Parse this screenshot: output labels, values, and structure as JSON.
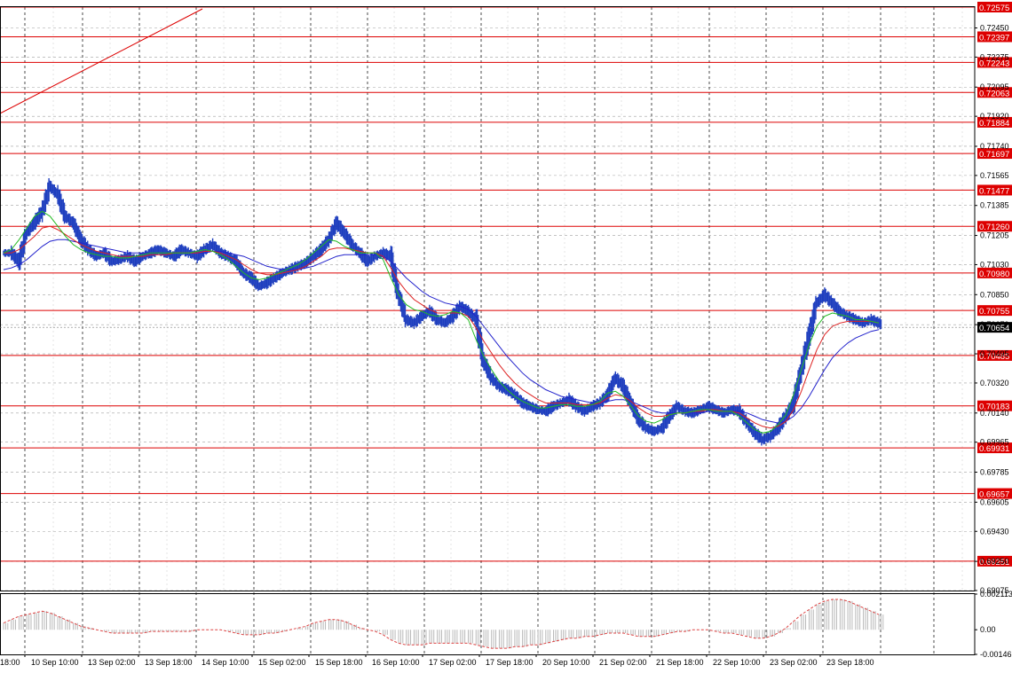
{
  "chart_data": {
    "type": "line",
    "style": "bars",
    "instrument_colors": {
      "price": "#1f3fbf",
      "ma_fast": "#22bb22",
      "ma_mid": "#dd2222",
      "ma_slow": "#2222cc",
      "levels": "#dd0000",
      "current_label_bg": "#000000",
      "grid": "#a0a0a0",
      "oscillator": "#dd4444"
    },
    "ylim": [
      0.69075,
      0.72575
    ],
    "y_ticks": [
      "0.72450",
      "0.72275",
      "0.72095",
      "0.71920",
      "0.71740",
      "0.71565",
      "0.71385",
      "0.71205",
      "0.71030",
      "0.70850",
      "0.70670",
      "0.70495",
      "0.70320",
      "0.70140",
      "0.69965",
      "0.69785",
      "0.69605",
      "0.69430",
      "0.69250",
      "0.69075"
    ],
    "x_labels": [
      "10 Sep 10:00",
      "13 Sep 02:00",
      "13 Sep 18:00",
      "14 Sep 10:00",
      "15 Sep 02:00",
      "15 Sep 18:00",
      "16 Sep 10:00",
      "17 Sep 02:00",
      "17 Sep 18:00",
      "20 Sep 10:00",
      "21 Sep 02:00",
      "21 Sep 18:00",
      "22 Sep 10:00",
      "23 Sep 02:00",
      "23 Sep 18:00"
    ],
    "x_label_left_partial": "18:00",
    "levels": [
      "0.72575",
      "0.72397",
      "0.72243",
      "0.72063",
      "0.71884",
      "0.71697",
      "0.71477",
      "0.71260",
      "0.70980",
      "0.70755",
      "0.70485",
      "0.70183",
      "0.69931",
      "0.69657",
      "0.69251"
    ],
    "current_price": "0.70654",
    "price_series": [
      0.711,
      0.7105,
      0.7122,
      0.7128,
      0.7135,
      0.715,
      0.7145,
      0.7132,
      0.7128,
      0.7118,
      0.7112,
      0.7108,
      0.711,
      0.7105,
      0.7106,
      0.7108,
      0.7105,
      0.7108,
      0.711,
      0.7112,
      0.711,
      0.7108,
      0.7112,
      0.711,
      0.7108,
      0.7112,
      0.7115,
      0.711,
      0.7108,
      0.7105,
      0.7098,
      0.7095,
      0.709,
      0.7092,
      0.7095,
      0.7098,
      0.71,
      0.7102,
      0.7104,
      0.7108,
      0.7112,
      0.7118,
      0.7128,
      0.7122,
      0.7115,
      0.711,
      0.7105,
      0.7108,
      0.711,
      0.7108,
      0.7085,
      0.707,
      0.7068,
      0.7072,
      0.7075,
      0.707,
      0.7068,
      0.7072,
      0.7078,
      0.7075,
      0.707,
      0.7045,
      0.7035,
      0.703,
      0.7028,
      0.7025,
      0.702,
      0.7018,
      0.7016,
      0.7015,
      0.7018,
      0.702,
      0.7022,
      0.7018,
      0.7015,
      0.7018,
      0.702,
      0.7025,
      0.7035,
      0.703,
      0.702,
      0.701,
      0.7005,
      0.7003,
      0.7005,
      0.7012,
      0.7018,
      0.7015,
      0.7014,
      0.7016,
      0.7018,
      0.7016,
      0.7014,
      0.7016,
      0.7015,
      0.7008,
      0.7002,
      0.6998,
      0.7,
      0.7005,
      0.7012,
      0.702,
      0.704,
      0.706,
      0.708,
      0.7085,
      0.708,
      0.7075,
      0.7072,
      0.707,
      0.7068,
      0.707,
      0.7068,
      0.70654
    ],
    "ma_fast_series": [
      0.711,
      0.7112,
      0.7118,
      0.7125,
      0.7132,
      0.7135,
      0.7132,
      0.7126,
      0.712,
      0.7115,
      0.7112,
      0.711,
      0.7109,
      0.7108,
      0.7108,
      0.7107,
      0.7107,
      0.7108,
      0.7109,
      0.711,
      0.711,
      0.711,
      0.711,
      0.711,
      0.711,
      0.7111,
      0.7112,
      0.7111,
      0.7109,
      0.7106,
      0.7102,
      0.7098,
      0.7095,
      0.7094,
      0.7095,
      0.7097,
      0.7099,
      0.7101,
      0.7103,
      0.7106,
      0.711,
      0.7114,
      0.7118,
      0.7117,
      0.7114,
      0.7112,
      0.711,
      0.711,
      0.711,
      0.7106,
      0.7095,
      0.7085,
      0.7079,
      0.7076,
      0.7075,
      0.7073,
      0.7072,
      0.7073,
      0.7075,
      0.7074,
      0.707,
      0.7058,
      0.7048,
      0.704,
      0.7033,
      0.7028,
      0.7024,
      0.7021,
      0.7019,
      0.7017,
      0.7017,
      0.7018,
      0.7019,
      0.7019,
      0.7018,
      0.7018,
      0.7019,
      0.7021,
      0.7026,
      0.7027,
      0.7024,
      0.7018,
      0.7012,
      0.7009,
      0.7008,
      0.701,
      0.7013,
      0.7014,
      0.7014,
      0.7015,
      0.7016,
      0.7016,
      0.7015,
      0.7015,
      0.7015,
      0.7012,
      0.7008,
      0.7004,
      0.7002,
      0.7003,
      0.7007,
      0.7013,
      0.7025,
      0.704,
      0.7055,
      0.7066,
      0.7072,
      0.7074,
      0.7073,
      0.7072,
      0.707,
      0.707,
      0.7069,
      0.7068
    ],
    "ma_mid_series": [
      0.711,
      0.711,
      0.7112,
      0.7116,
      0.712,
      0.7125,
      0.7126,
      0.7124,
      0.7121,
      0.7118,
      0.7115,
      0.7113,
      0.7111,
      0.711,
      0.7109,
      0.7108,
      0.7108,
      0.7108,
      0.7108,
      0.7109,
      0.7109,
      0.7109,
      0.711,
      0.711,
      0.711,
      0.711,
      0.7111,
      0.7111,
      0.711,
      0.7108,
      0.7106,
      0.7103,
      0.71,
      0.7098,
      0.7097,
      0.7097,
      0.7098,
      0.7099,
      0.71,
      0.7102,
      0.7105,
      0.7108,
      0.7112,
      0.7113,
      0.7113,
      0.7112,
      0.7111,
      0.711,
      0.711,
      0.7108,
      0.7101,
      0.7093,
      0.7087,
      0.7082,
      0.7079,
      0.7076,
      0.7074,
      0.7074,
      0.7074,
      0.7074,
      0.7072,
      0.7065,
      0.7057,
      0.705,
      0.7043,
      0.7037,
      0.7032,
      0.7028,
      0.7025,
      0.7022,
      0.702,
      0.702,
      0.702,
      0.702,
      0.7019,
      0.7019,
      0.7019,
      0.702,
      0.7023,
      0.7025,
      0.7024,
      0.7021,
      0.7017,
      0.7014,
      0.7012,
      0.7012,
      0.7013,
      0.7014,
      0.7014,
      0.7015,
      0.7015,
      0.7016,
      0.7016,
      0.7015,
      0.7015,
      0.7014,
      0.7011,
      0.7008,
      0.7006,
      0.7005,
      0.7006,
      0.7009,
      0.7016,
      0.7027,
      0.704,
      0.7052,
      0.7061,
      0.7066,
      0.7068,
      0.7069,
      0.7069,
      0.7069,
      0.7069,
      0.7068
    ],
    "ma_slow_series": [
      0.71,
      0.7101,
      0.7103,
      0.7106,
      0.711,
      0.7114,
      0.7117,
      0.7118,
      0.7118,
      0.7117,
      0.7116,
      0.7115,
      0.7114,
      0.7113,
      0.7112,
      0.7111,
      0.711,
      0.711,
      0.711,
      0.711,
      0.711,
      0.711,
      0.711,
      0.711,
      0.711,
      0.711,
      0.711,
      0.7111,
      0.7111,
      0.711,
      0.7109,
      0.7108,
      0.7106,
      0.7104,
      0.7102,
      0.7101,
      0.71,
      0.71,
      0.71,
      0.7101,
      0.7102,
      0.7104,
      0.7106,
      0.7108,
      0.7109,
      0.7109,
      0.7109,
      0.7109,
      0.7109,
      0.7108,
      0.7105,
      0.71,
      0.7095,
      0.7091,
      0.7087,
      0.7084,
      0.7082,
      0.708,
      0.7079,
      0.7078,
      0.7076,
      0.7072,
      0.7066,
      0.706,
      0.7054,
      0.7048,
      0.7043,
      0.7038,
      0.7034,
      0.7031,
      0.7028,
      0.7026,
      0.7024,
      0.7023,
      0.7022,
      0.7021,
      0.702,
      0.702,
      0.7021,
      0.7022,
      0.7022,
      0.7021,
      0.7019,
      0.7017,
      0.7015,
      0.7014,
      0.7014,
      0.7014,
      0.7014,
      0.7014,
      0.7014,
      0.7015,
      0.7015,
      0.7015,
      0.7015,
      0.7015,
      0.7014,
      0.7012,
      0.701,
      0.7009,
      0.7008,
      0.7009,
      0.7012,
      0.7017,
      0.7024,
      0.7032,
      0.704,
      0.7047,
      0.7052,
      0.7056,
      0.7059,
      0.7061,
      0.7063,
      0.7064
    ],
    "oscillator": {
      "ticks": [
        "0.002113",
        "0.00",
        "-0.00146"
      ],
      "ylim": [
        -0.00146,
        0.002113
      ],
      "values": [
        0.0004,
        0.0006,
        0.0008,
        0.0009,
        0.001,
        0.0011,
        0.001,
        0.0008,
        0.0006,
        0.0004,
        0.0002,
        0.0001,
        0.0,
        -0.0001,
        -0.0002,
        -0.0002,
        -0.0002,
        -0.0002,
        -0.0002,
        -0.0001,
        -0.0001,
        -0.0001,
        -0.0001,
        -0.0001,
        -0.0001,
        0.0,
        0.0,
        0.0,
        0.0,
        -0.0001,
        -0.0002,
        -0.0003,
        -0.0003,
        -0.0003,
        -0.0002,
        -0.0002,
        -0.0001,
        0.0,
        0.0001,
        0.0002,
        0.0004,
        0.0005,
        0.0006,
        0.0006,
        0.0005,
        0.0003,
        0.0001,
        0.0,
        -0.0001,
        -0.0003,
        -0.0006,
        -0.0008,
        -0.0009,
        -0.0009,
        -0.0009,
        -0.0008,
        -0.0008,
        -0.0008,
        -0.0008,
        -0.0008,
        -0.0008,
        -0.0009,
        -0.001,
        -0.0011,
        -0.0011,
        -0.0011,
        -0.001,
        -0.001,
        -0.0009,
        -0.0009,
        -0.0008,
        -0.0007,
        -0.0006,
        -0.0005,
        -0.0005,
        -0.0004,
        -0.0004,
        -0.0003,
        -0.0002,
        -0.0002,
        -0.0002,
        -0.0003,
        -0.0004,
        -0.0004,
        -0.0004,
        -0.0003,
        -0.0002,
        -0.0001,
        -0.0001,
        0.0,
        0.0,
        0.0,
        -0.0001,
        -0.0002,
        -0.0002,
        -0.0003,
        -0.0004,
        -0.0005,
        -0.0005,
        -0.0004,
        -0.0002,
        0.0001,
        0.0005,
        0.0009,
        0.0012,
        0.0015,
        0.0017,
        0.0018,
        0.0018,
        0.0017,
        0.0015,
        0.0013,
        0.0011,
        0.0009
      ]
    },
    "grid": true
  }
}
